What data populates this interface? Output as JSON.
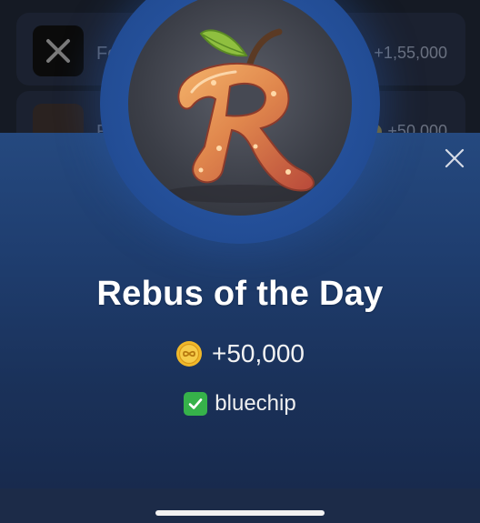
{
  "background_tasks": [
    {
      "icon": "x-logo-icon",
      "label": "Follo",
      "reward": "+1,55,000"
    },
    {
      "icon": "apple-r-icon",
      "label": "Re",
      "reward": "+50,000"
    }
  ],
  "sheet": {
    "title": "Rebus of the Day",
    "reward": "+50,000",
    "author": "bluechip",
    "close_icon": "close-icon",
    "coin_icon": "coin-icon",
    "verified_icon": "check-icon"
  },
  "colors": {
    "sheet_top": "#25497f",
    "sheet_bottom": "#17284a",
    "check_green": "#36b24a",
    "coin_gold": "#f0b82a"
  }
}
